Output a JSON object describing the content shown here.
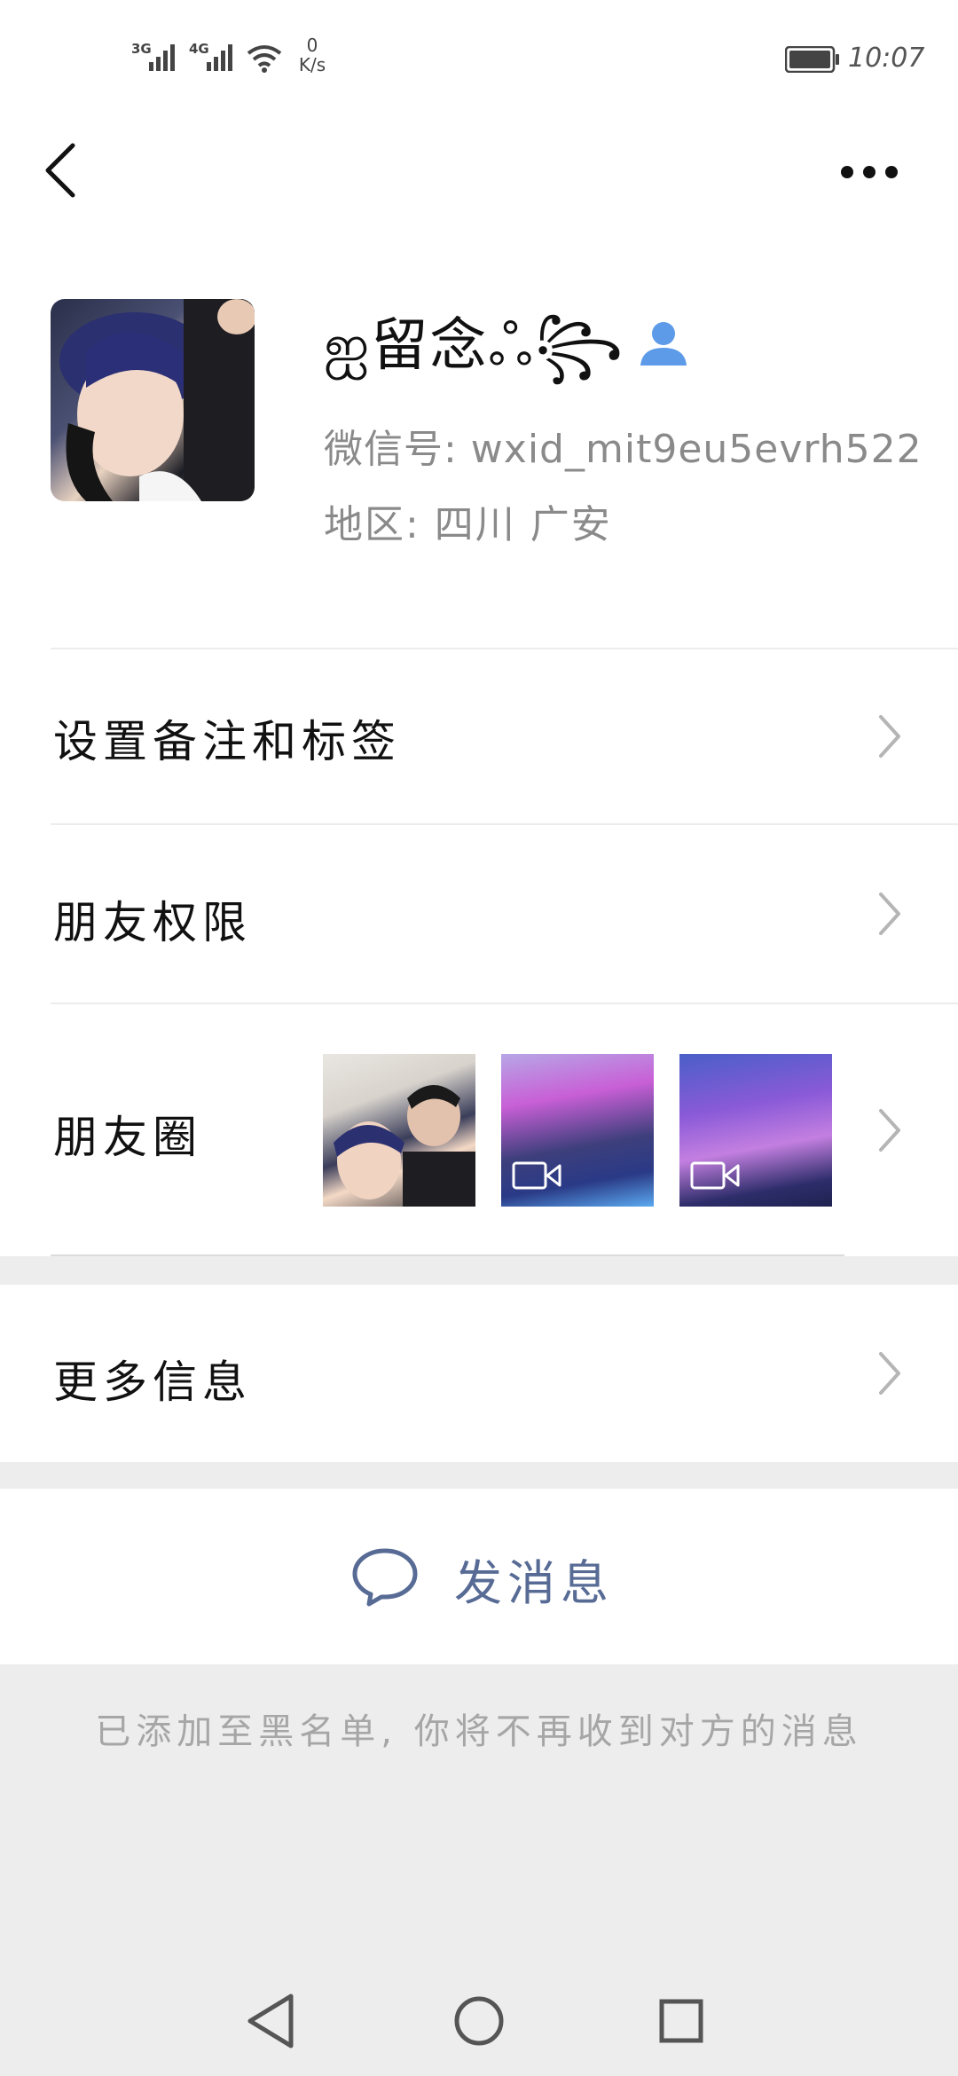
{
  "status_bar": {
    "network_1": "3G",
    "network_2": "4G",
    "speed_value": "0",
    "speed_unit": "K/s",
    "time": "10:07"
  },
  "nav": {
    "back_icon": "chevron-left-icon",
    "more_icon": "more-dots-icon"
  },
  "profile": {
    "nickname": "ஐ留念ஃ꧂",
    "contact_icon": "person-icon",
    "wechat_id": "微信号:  wxid_mit9eu5evrh522",
    "region": "地区:  四川   广安"
  },
  "rows": {
    "remarks_tags": "设置备注和标签",
    "friend_permissions": "朋友权限",
    "moments": "朋友圈",
    "more_info": "更多信息"
  },
  "moments_thumbs": [
    {
      "type": "photo"
    },
    {
      "type": "video",
      "icon": "video-camera-icon"
    },
    {
      "type": "video",
      "icon": "video-camera-icon"
    }
  ],
  "actions": {
    "send_message": "发消息",
    "send_icon": "chat-bubble-icon"
  },
  "notice": "已添加至黑名单, 你将不再收到对方的消息",
  "colors": {
    "link_blue": "#576b95",
    "muted_gray": "#8a8a8a",
    "band_gray": "#ededed",
    "contact_icon_blue": "#5d9be8"
  }
}
